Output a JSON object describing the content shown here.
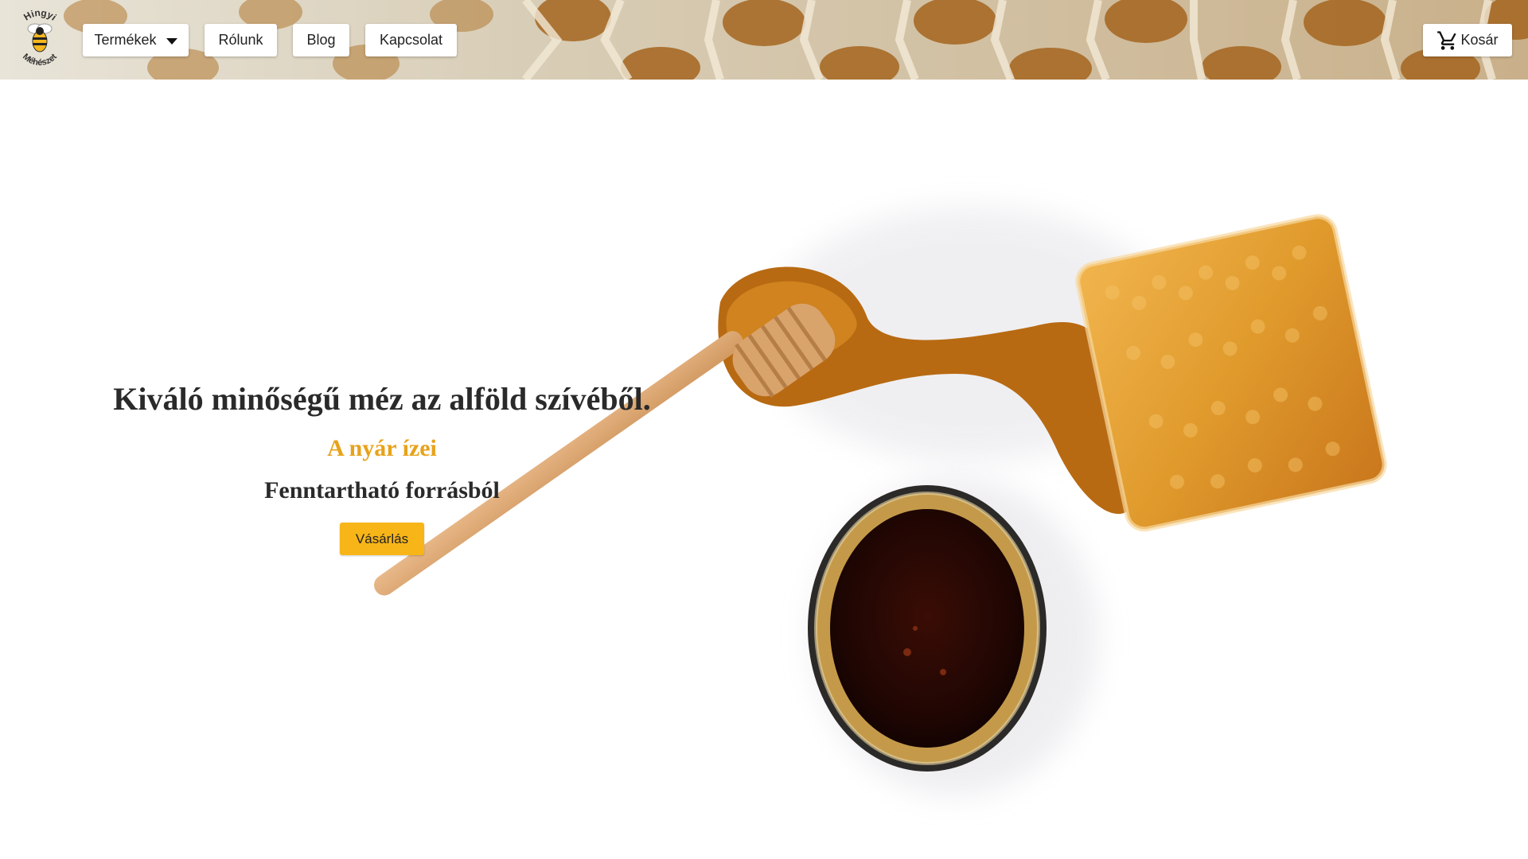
{
  "logo": {
    "top_text": "Hingyi",
    "bottom_text": "Méhészet",
    "icon": "bee-icon"
  },
  "nav": {
    "products_label": "Termékek",
    "products_icon": "caret-down-icon",
    "about_label": "Rólunk",
    "blog_label": "Blog",
    "contact_label": "Kapcsolat"
  },
  "cart": {
    "label": "Kosár",
    "icon": "cart-icon"
  },
  "hero": {
    "title": "Kiváló minőségű méz az alföld szívéből.",
    "subtitle": "A nyár ízei",
    "tagline": "Fenntartható forrásból",
    "cta_label": "Vásárlás"
  },
  "colors": {
    "accent": "#f7b518",
    "subtitle": "#e8a21a",
    "text": "#2a2a2a",
    "header_bg": "#d9d3c4"
  }
}
